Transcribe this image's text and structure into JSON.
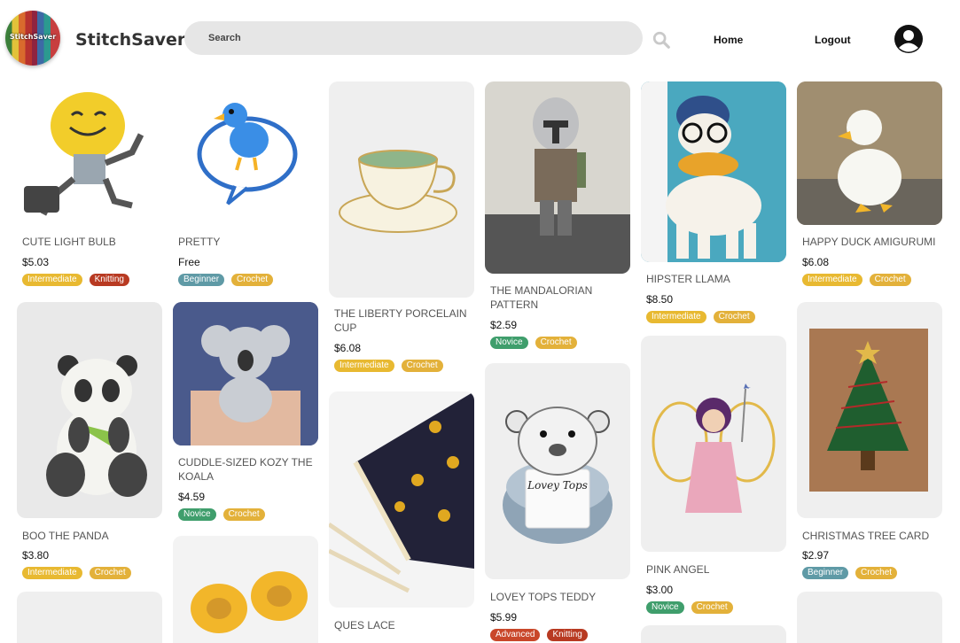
{
  "app": {
    "logo_text": "StitchSaver",
    "brand": "StitchSaver",
    "search_placeholder": "Search",
    "nav_home": "Home",
    "nav_logout": "Logout"
  },
  "colors": {
    "intermediate": "#e8b931",
    "knitting": "#b83a22",
    "beginner": "#5f9aa6",
    "crochet": "#e3b13a",
    "novice": "#3f9e6c",
    "advanced": "#c9472a"
  },
  "cards": [
    {
      "title": "CUTE LIGHT BULB",
      "price": "$5.03",
      "tags": [
        "Intermediate",
        "Knitting"
      ]
    },
    {
      "title": "PRETTY",
      "price": "Free",
      "tags": [
        "Beginner",
        "Crochet"
      ]
    },
    {
      "title": "THE LIBERTY PORCELAIN CUP",
      "price": "$6.08",
      "tags": [
        "Intermediate",
        "Crochet"
      ]
    },
    {
      "title": "THE MANDALORIAN PATTERN",
      "price": "$2.59",
      "tags": [
        "Novice",
        "Crochet"
      ]
    },
    {
      "title": "HIPSTER LLAMA",
      "price": "$8.50",
      "tags": [
        "Intermediate",
        "Crochet"
      ]
    },
    {
      "title": "HAPPY DUCK AMIGURUMI",
      "price": "$6.08",
      "tags": [
        "Intermediate",
        "Crochet"
      ]
    },
    {
      "title": "BOO THE PANDA",
      "price": "$3.80",
      "tags": [
        "Intermediate",
        "Crochet"
      ]
    },
    {
      "title": "CUDDLE-SIZED KOZY THE KOALA",
      "price": "$4.59",
      "tags": [
        "Novice",
        "Crochet"
      ]
    },
    {
      "title": "QUES LACE",
      "price": "",
      "tags": []
    },
    {
      "title": "LOVEY TOPS TEDDY",
      "price": "$5.99",
      "tags": [
        "Advanced",
        "Knitting"
      ]
    },
    {
      "title": "PINK ANGEL",
      "price": "$3.00",
      "tags": [
        "Novice",
        "Crochet"
      ]
    },
    {
      "title": "CHRISTMAS TREE CARD",
      "price": "$2.97",
      "tags": [
        "Beginner",
        "Crochet"
      ]
    }
  ],
  "product_label": "Lovey Tops"
}
